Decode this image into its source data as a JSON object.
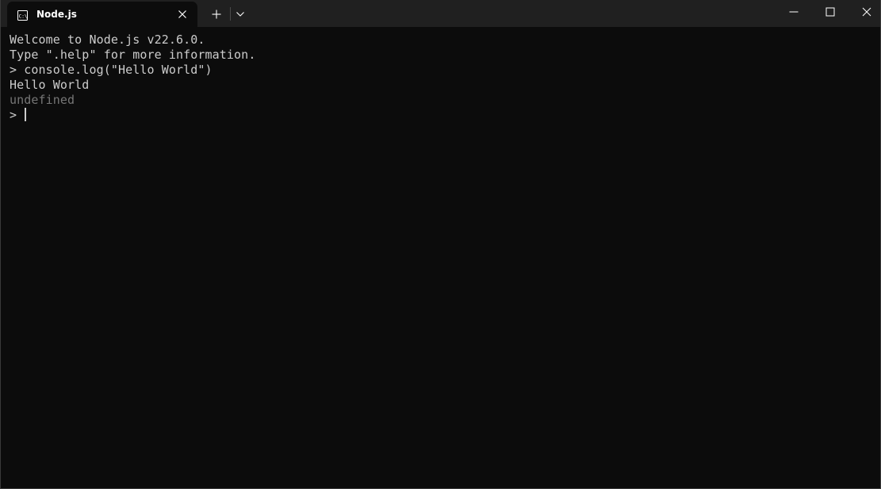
{
  "tab": {
    "title": "Node.js",
    "icon": "terminal-icon"
  },
  "titlebar": {
    "new_tab_icon": "plus-icon",
    "dropdown_icon": "chevron-down-icon",
    "minimize_icon": "minimize-icon",
    "maximize_icon": "maximize-icon",
    "close_icon": "close-icon"
  },
  "terminal": {
    "lines": [
      {
        "text": "Welcome to Node.js v22.6.0."
      },
      {
        "text": "Type \".help\" for more information."
      },
      {
        "text": "> console.log(\"Hello World\")"
      },
      {
        "text": "Hello World"
      },
      {
        "text": "undefined"
      }
    ],
    "prompt": "> ",
    "colors": {
      "background": "#0c0c0c",
      "foreground": "#cccccc",
      "dim": "#767676",
      "titlebar": "#202020"
    }
  }
}
